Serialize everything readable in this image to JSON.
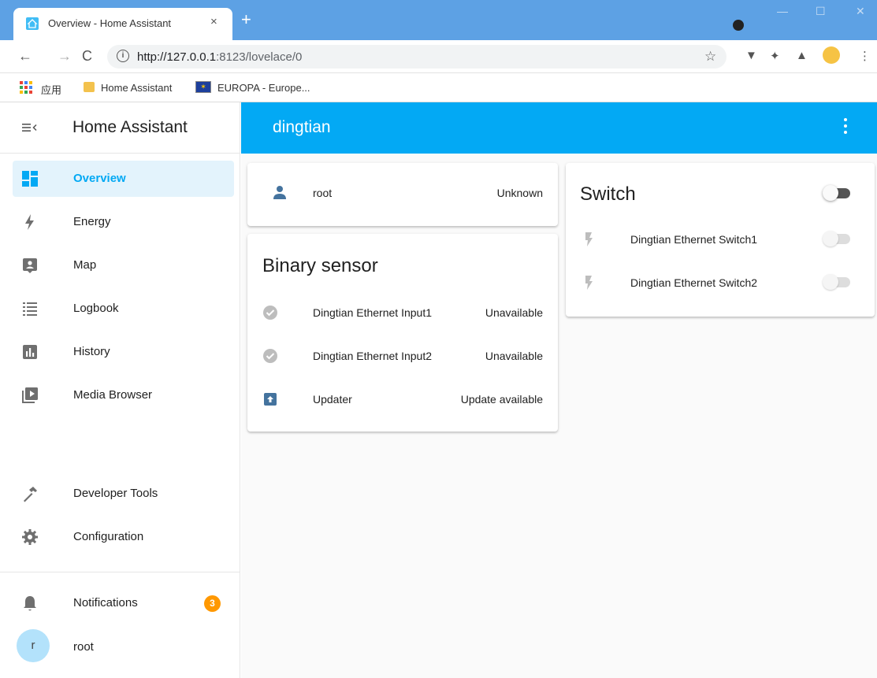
{
  "browser": {
    "tab_title": "Overview - Home Assistant",
    "tab_close": "×",
    "new_tab": "+",
    "url_host": "http://127.0.0.1",
    "url_rest": ":8123/lovelace/0",
    "bookmarks": [
      {
        "label": "应用",
        "icon": "apps-grid-icon"
      },
      {
        "label": "Home Assistant",
        "icon": "folder-icon"
      },
      {
        "label": "EUROPA - Europe...",
        "icon": "eu-flag-icon"
      }
    ]
  },
  "sidebar": {
    "title": "Home Assistant",
    "items": [
      {
        "label": "Overview",
        "icon": "dashboard-icon",
        "active": true
      },
      {
        "label": "Energy",
        "icon": "lightning-icon"
      },
      {
        "label": "Map",
        "icon": "map-account-icon"
      },
      {
        "label": "Logbook",
        "icon": "logbook-list-icon"
      },
      {
        "label": "History",
        "icon": "chart-box-icon"
      },
      {
        "label": "Media Browser",
        "icon": "media-play-icon"
      },
      {
        "label": "Developer Tools",
        "icon": "hammer-icon"
      },
      {
        "label": "Configuration",
        "icon": "cog-icon"
      }
    ],
    "notifications": {
      "label": "Notifications",
      "count": "3",
      "icon": "bell-icon"
    },
    "user": {
      "label": "root",
      "initial": "r"
    }
  },
  "header": {
    "title": "dingtian"
  },
  "cards": {
    "person": {
      "name": "root",
      "state": "Unknown"
    },
    "binary_sensor": {
      "title": "Binary sensor",
      "rows": [
        {
          "name": "Dingtian Ethernet Input1",
          "state": "Unavailable",
          "icon": "check-circle-icon"
        },
        {
          "name": "Dingtian Ethernet Input2",
          "state": "Unavailable",
          "icon": "check-circle-icon"
        },
        {
          "name": "Updater",
          "state": "Update available",
          "icon": "package-up-icon"
        }
      ]
    },
    "switch": {
      "title": "Switch",
      "rows": [
        {
          "name": "Dingtian Ethernet Switch1",
          "icon": "flash-off-icon"
        },
        {
          "name": "Dingtian Ethernet Switch2",
          "icon": "flash-off-icon"
        }
      ]
    }
  },
  "colors": {
    "accent": "#03a9f4",
    "browser_frame": "#5da1e4",
    "badge": "#ff9800",
    "icon_primary": "#44739e"
  }
}
